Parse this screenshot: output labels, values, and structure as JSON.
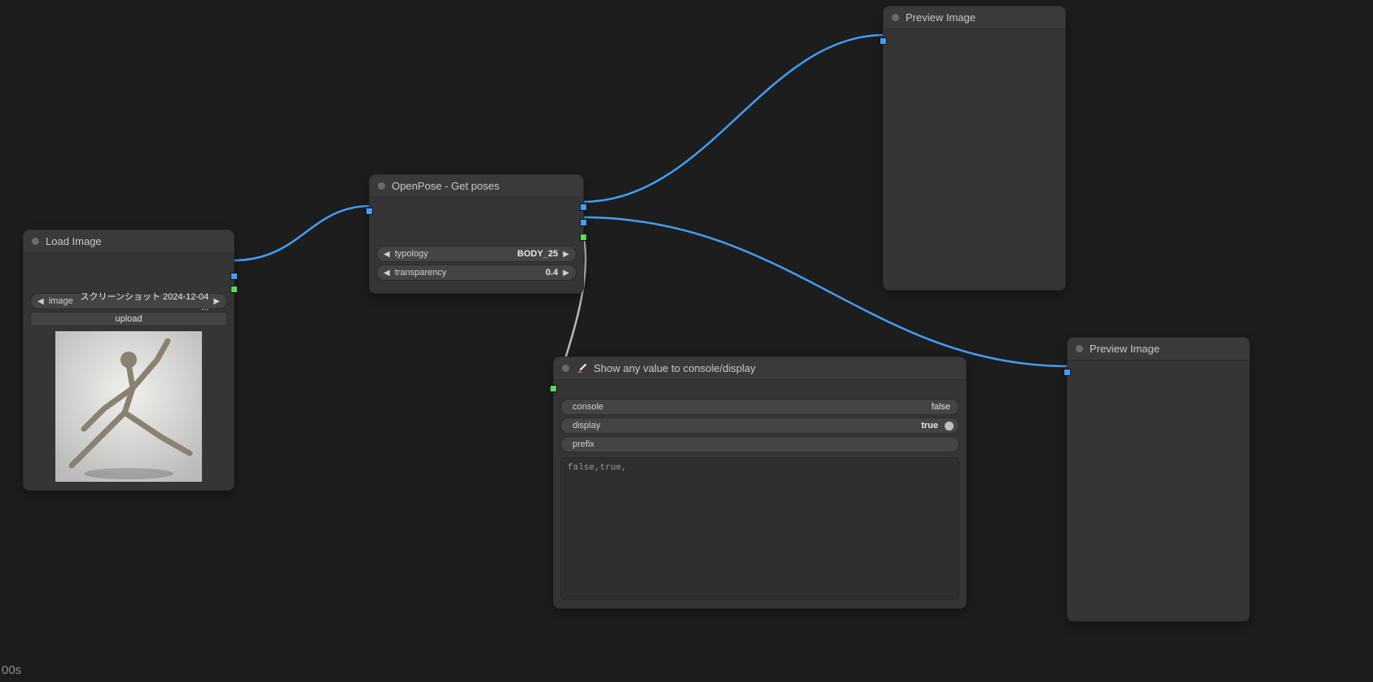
{
  "status": "00s",
  "nodes": {
    "loadImage": {
      "title": "Load Image",
      "image_label": "image",
      "image_value": "スクリーンショット 2024-12-04 ...",
      "upload_label": "upload"
    },
    "openpose": {
      "title": "OpenPose - Get poses",
      "typology_label": "typology",
      "typology_value": "BODY_25",
      "transparency_label": "transparency",
      "transparency_value": "0.4"
    },
    "showValue": {
      "title": "Show any value to console/display",
      "console_label": "console",
      "console_value": "false",
      "display_label": "display",
      "display_value": "true",
      "prefix_label": "prefix",
      "output": "false,true,"
    },
    "preview1": {
      "title": "Preview Image"
    },
    "preview2": {
      "title": "Preview Image"
    }
  },
  "wire_color_image": "#429ef5",
  "wire_color_data": "#b8b8b8"
}
